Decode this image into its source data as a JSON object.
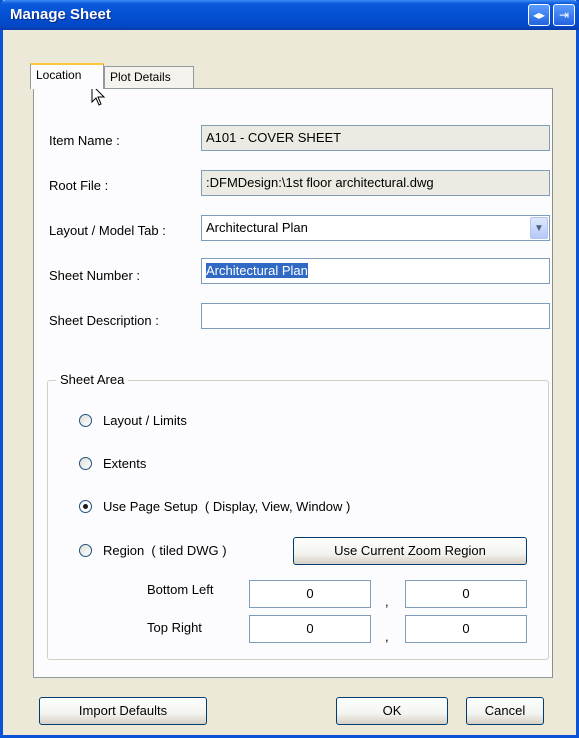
{
  "window": {
    "title": "Manage Sheet",
    "title_buttons": [
      "◂▸",
      "⇥"
    ]
  },
  "tabs": [
    {
      "label": "Location",
      "active": true
    },
    {
      "label": "Plot Details",
      "active": false
    }
  ],
  "fields": {
    "item_name": {
      "label": "Item Name :",
      "value": "A101 - COVER SHEET"
    },
    "root_file": {
      "label": "Root File :",
      "value": ":DFMDesign:\\1st floor architectural.dwg"
    },
    "layout_tab": {
      "label": "Layout / Model Tab :",
      "value": "Architectural Plan"
    },
    "sheet_number": {
      "label": "Sheet Number :",
      "value": "Architectural Plan"
    },
    "sheet_description": {
      "label": "Sheet Description :",
      "value": ""
    }
  },
  "sheet_area": {
    "legend": "Sheet Area",
    "options": [
      {
        "label": "Layout / Limits",
        "checked": false
      },
      {
        "label": "Extents",
        "checked": false
      },
      {
        "label": "Use Page Setup  ( Display, View, Window )",
        "checked": true
      },
      {
        "label": "Region  ( tiled DWG )",
        "checked": false
      }
    ],
    "zoom_button": "Use Current Zoom Region",
    "bottom_left": {
      "label": "Bottom Left",
      "x": "0",
      "y": "0"
    },
    "top_right": {
      "label": "Top Right",
      "x": "0",
      "y": "0"
    },
    "comma": ","
  },
  "buttons": {
    "import_defaults": "Import Defaults",
    "ok": "OK",
    "cancel": "Cancel"
  },
  "colors": {
    "titlebar": "#0450d4",
    "selection": "#316ac5",
    "dialog_bg": "#ece9d8"
  }
}
